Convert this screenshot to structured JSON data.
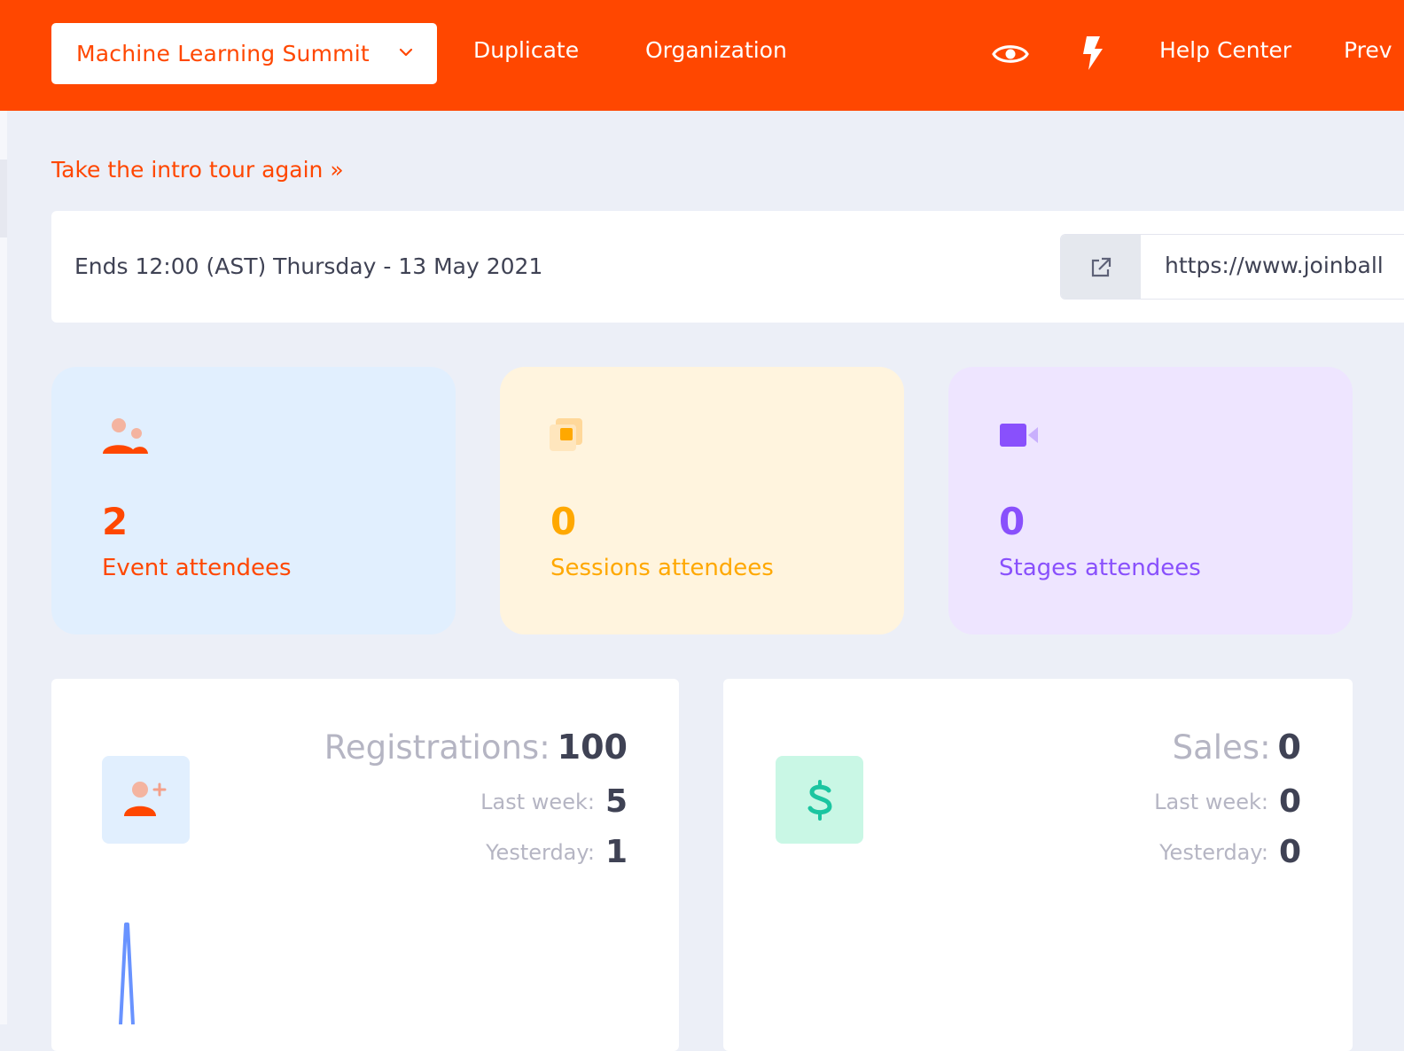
{
  "header": {
    "event_name": "Machine Learning Summit",
    "nav": {
      "duplicate": "Duplicate",
      "organization": "Organization",
      "help": "Help Center",
      "preview_partial": "Prev"
    },
    "icons": [
      "eye-icon",
      "lightning-icon",
      "chevron-down-icon"
    ]
  },
  "tour_link": "Take the intro tour again »",
  "info": {
    "ends": "Ends 12:00 (AST) Thursday - 13 May 2021",
    "url": "https://www.joinball"
  },
  "stats": [
    {
      "value": "2",
      "label": "Event attendees",
      "icon": "users-icon",
      "color": "#ff4700",
      "bg": "#e1effe"
    },
    {
      "value": "0",
      "label": "Sessions attendees",
      "icon": "layers-icon",
      "color": "#ffa800",
      "bg": "#fff4de"
    },
    {
      "value": "0",
      "label": "Stages attendees",
      "icon": "video-camera-icon",
      "color": "#8950fc",
      "bg": "#eee5ff"
    }
  ],
  "registrations": {
    "title": "Registrations:",
    "total": "100",
    "last_week_label": "Last week:",
    "last_week": "5",
    "yesterday_label": "Yesterday:",
    "yesterday": "1",
    "icon": "add-user-icon"
  },
  "sales": {
    "title": "Sales:",
    "total": "0",
    "last_week_label": "Last week:",
    "last_week": "0",
    "yesterday_label": "Yesterday:",
    "yesterday": "0",
    "icon": "dollar-icon"
  },
  "colors": {
    "brand": "#ff4700",
    "sparkline": "#6993ff",
    "sales_icon_bg": "#c9f7e5",
    "sales_icon": "#1bc5bd"
  }
}
